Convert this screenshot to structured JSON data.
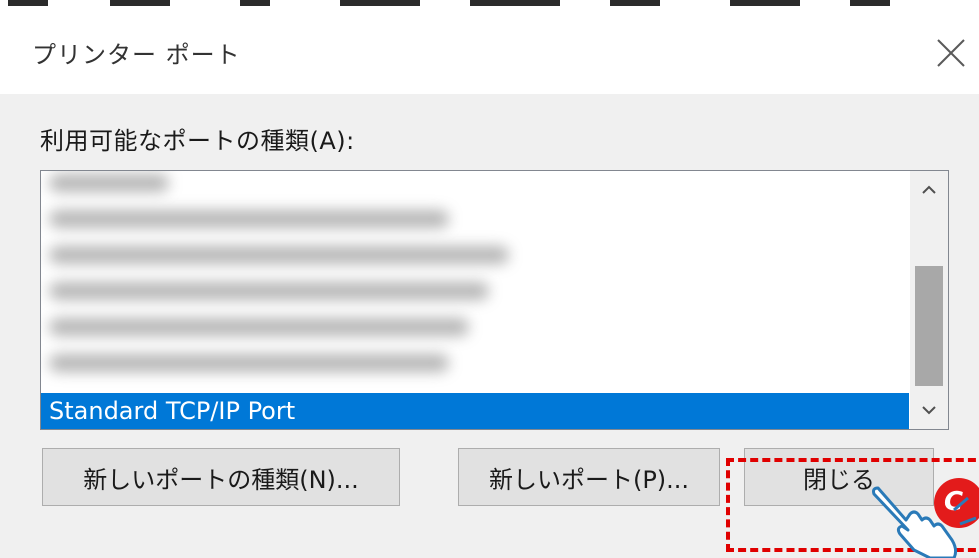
{
  "window": {
    "title": "プリンター ポート"
  },
  "port_list": {
    "label": "利用可能なポートの種類(A):",
    "items": [
      {
        "label": "",
        "blurred": true
      },
      {
        "label": "",
        "blurred": true
      },
      {
        "label": "",
        "blurred": true
      },
      {
        "label": "",
        "blurred": true
      },
      {
        "label": "",
        "blurred": true
      },
      {
        "label": "",
        "blurred": true
      },
      {
        "label": "Standard TCP/IP Port",
        "blurred": false,
        "selected": true
      }
    ],
    "selected_color": "#0078d7"
  },
  "buttons": {
    "new_port_type": "新しいポートの種類(N)...",
    "new_port": "新しいポート(P)...",
    "close": "閉じる"
  },
  "annotation": {
    "badge_text": "C",
    "highlight_color": "#e00000"
  },
  "icons": {
    "close": "close-x-icon",
    "scroll_up": "chevron-up-icon",
    "scroll_down": "chevron-down-icon",
    "pointer": "pointing-hand-icon"
  }
}
